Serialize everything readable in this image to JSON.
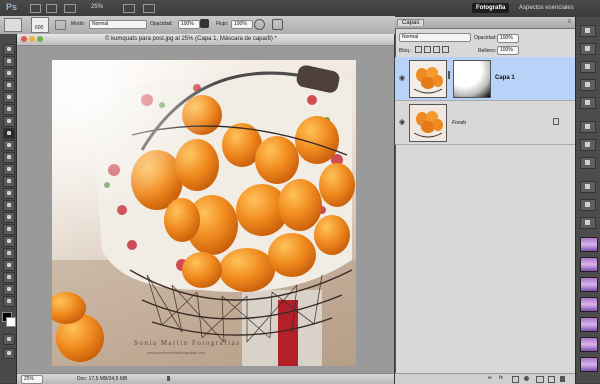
{
  "app": {
    "logo": "Ps"
  },
  "options_bar": {
    "brush_size": "600",
    "mode_label": "Modo:",
    "mode_value": "Normal",
    "opacity_label": "Opacidad:",
    "opacity_value": "100%",
    "flow_label": "Flujo:",
    "flow_value": "100%"
  },
  "top_bar": {
    "zoom_value": "25%",
    "workspace_active": "Fotografía",
    "workspace_other": "Aspectos esenciales"
  },
  "document": {
    "tab_title": "© kumquats para post.jpg al 25% (Capa 1, Máscara de capa/8) *",
    "watermark_title": "Sonia Martín Fotografías",
    "watermark_url": "www.sonimartinlafotografias.com",
    "status_zoom": "25%",
    "status_doc": "Doc: 17,5 MB/34,5 MB"
  },
  "layers_panel": {
    "tab_label": "Capas",
    "blend_mode": "Normal",
    "opacity_label": "Opacidad:",
    "opacity_value": "100%",
    "lock_label": "Bloq.:",
    "fill_label": "Relleno:",
    "fill_value": "100%",
    "layers": [
      {
        "name": "Capa 1",
        "selected": true
      },
      {
        "name": "Fondo",
        "selected": false
      }
    ]
  },
  "colors": {
    "selection": "#b8d3f7",
    "panel_bg": "#d8d8d8",
    "workspace_active_bg": "#1d1d1d"
  }
}
